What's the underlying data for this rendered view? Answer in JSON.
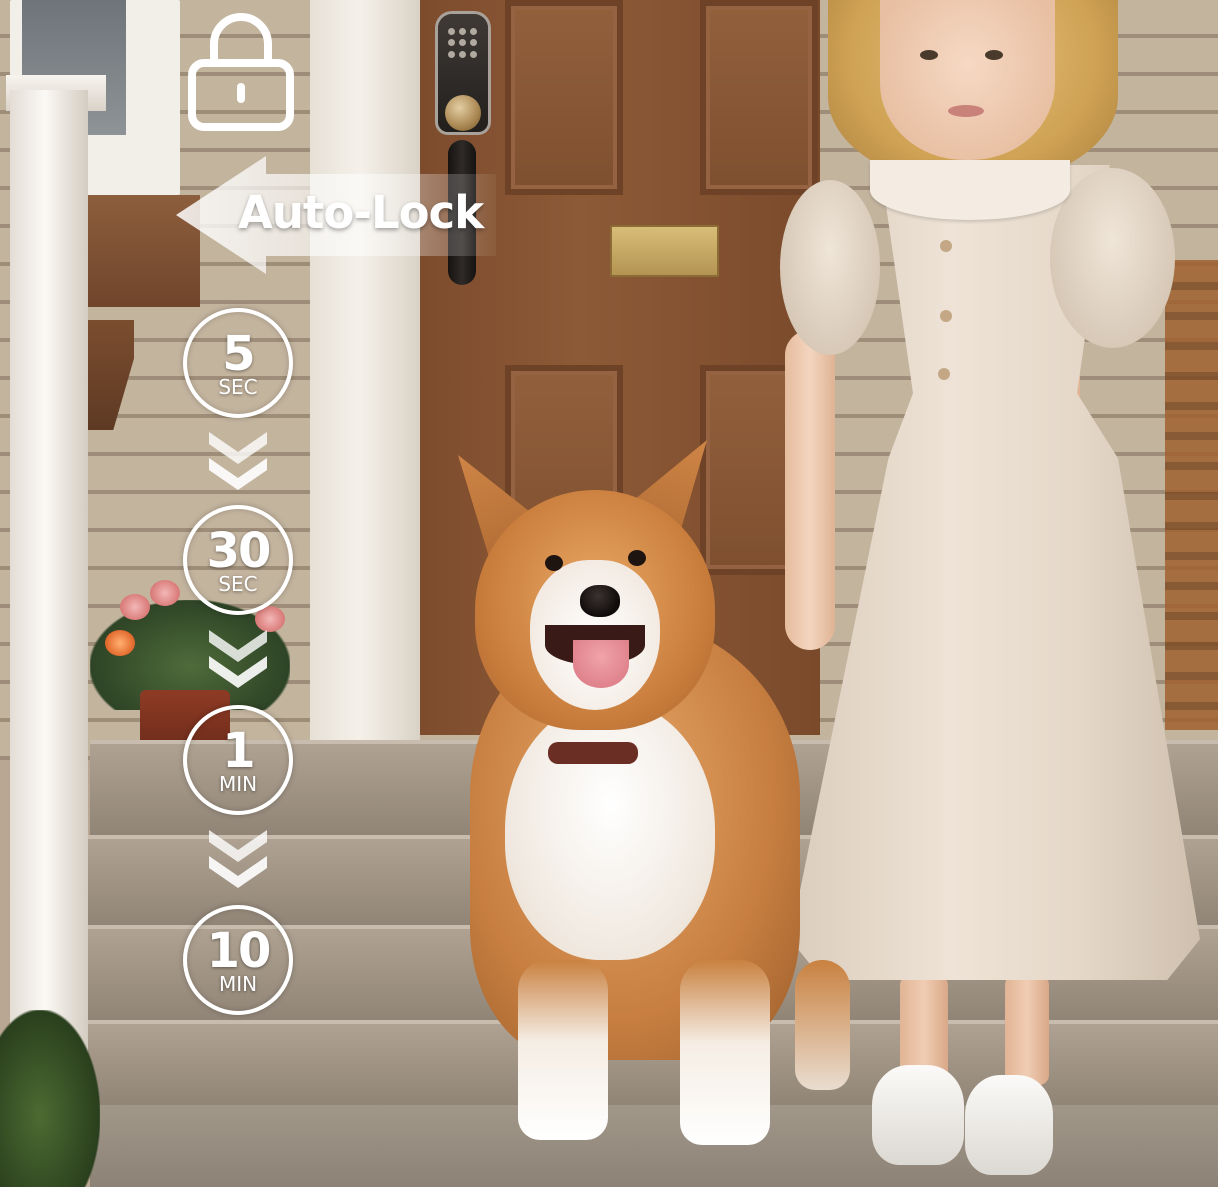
{
  "feature": {
    "title": "Auto-Lock"
  },
  "timers": [
    {
      "value": "5",
      "unit": "SEC"
    },
    {
      "value": "30",
      "unit": "SEC"
    },
    {
      "value": "1",
      "unit": "MIN"
    },
    {
      "value": "10",
      "unit": "MIN"
    }
  ],
  "icons": {
    "lock": "lock-icon",
    "arrow": "arrow-left-banner",
    "chevron": "chevron-double-down-icon"
  },
  "colors": {
    "overlay_text": "#ffffff",
    "door": "#8d5a37",
    "siding": "#c3b49e"
  }
}
